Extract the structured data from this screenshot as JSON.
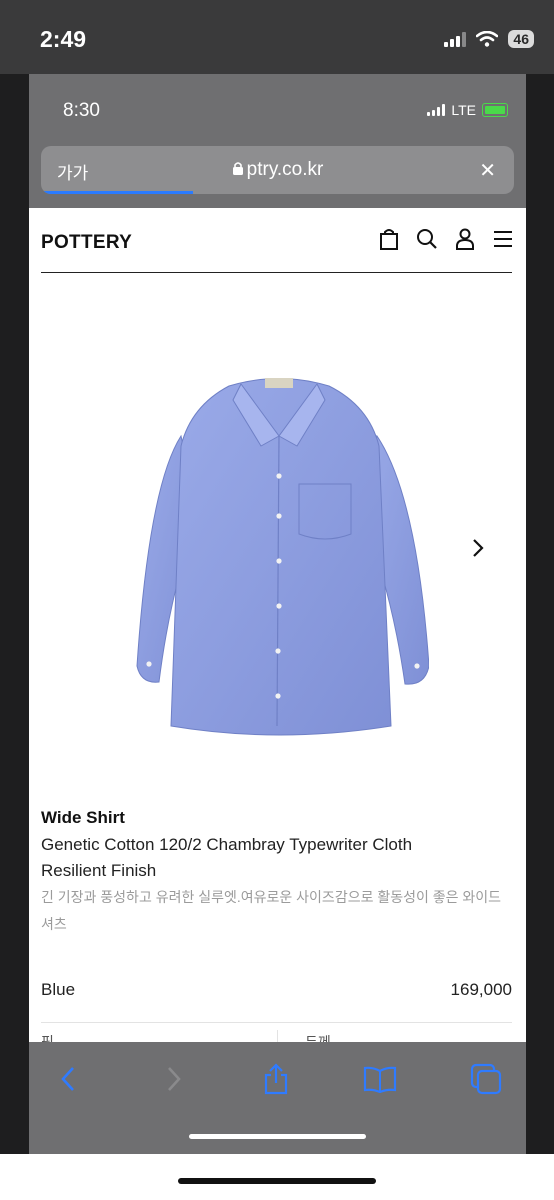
{
  "outer_status": {
    "time": "2:49",
    "battery": "46"
  },
  "browser": {
    "status_time": "8:30",
    "network": "LTE",
    "text_size_label": "가가",
    "url": "ptry.co.kr"
  },
  "site": {
    "logo": "POTTERY",
    "header_icons": [
      "bag-icon",
      "search-icon",
      "user-icon",
      "menu-icon"
    ]
  },
  "product": {
    "name": "Wide Shirt",
    "description": "Genetic Cotton 120/2 Chambray Typewriter Cloth Resilient Finish",
    "description_kr": "긴 기장과 풍성하고 유려한 실루엣.여유로운 사이즈감으로 활동성이 좋은 와이드 셔츠",
    "color": "Blue",
    "price": "169,000",
    "option_a": "핏",
    "option_b": "두께",
    "shirt_color": "#8e9fe0"
  },
  "toolbar": {
    "icons": [
      "back-icon",
      "forward-icon",
      "share-icon",
      "bookmarks-icon",
      "tabs-icon"
    ]
  }
}
